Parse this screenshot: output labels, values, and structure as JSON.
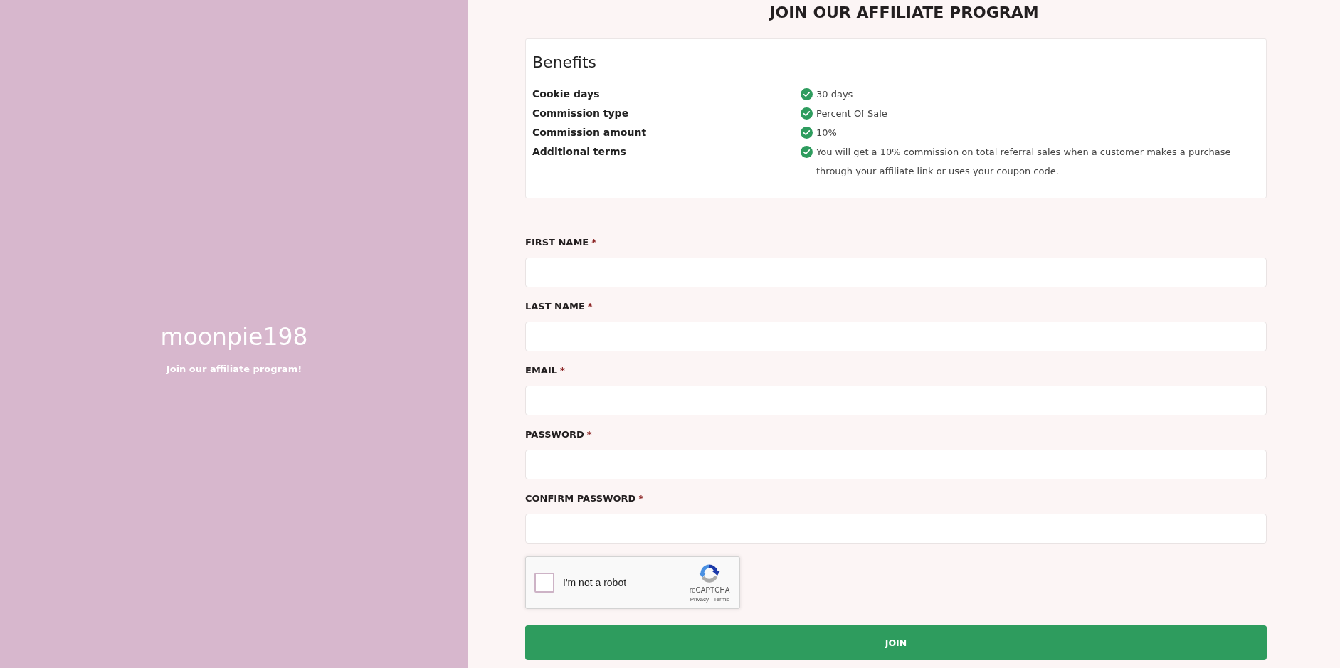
{
  "brand_panel": {
    "name": "moonpie198",
    "tagline": "Join our affiliate program!"
  },
  "page_title": "JOIN OUR AFFILIATE PROGRAM",
  "benefits": {
    "heading": "Benefits",
    "items": [
      {
        "label": "Cookie days",
        "value": "30 days"
      },
      {
        "label": "Commission type",
        "value": "Percent Of Sale"
      },
      {
        "label": "Commission amount",
        "value": "10%"
      },
      {
        "label": "Additional terms",
        "value": "You will get a 10% commission on total referral sales when a customer makes a purchase through your affiliate link or uses your coupon code."
      }
    ]
  },
  "form": {
    "fields": [
      {
        "label": "FIRST NAME",
        "required_mark": "*"
      },
      {
        "label": "LAST NAME",
        "required_mark": "*"
      },
      {
        "label": "EMAIL",
        "required_mark": "*"
      },
      {
        "label": "PASSWORD",
        "required_mark": "*"
      },
      {
        "label": "CONFIRM PASSWORD",
        "required_mark": "*"
      }
    ],
    "captcha": {
      "label": "I'm not a robot",
      "checked": false,
      "brand": "reCAPTCHA",
      "privacy_link": "Privacy",
      "separator": "-",
      "terms_link": "Terms"
    },
    "submit": "JOIN"
  }
}
